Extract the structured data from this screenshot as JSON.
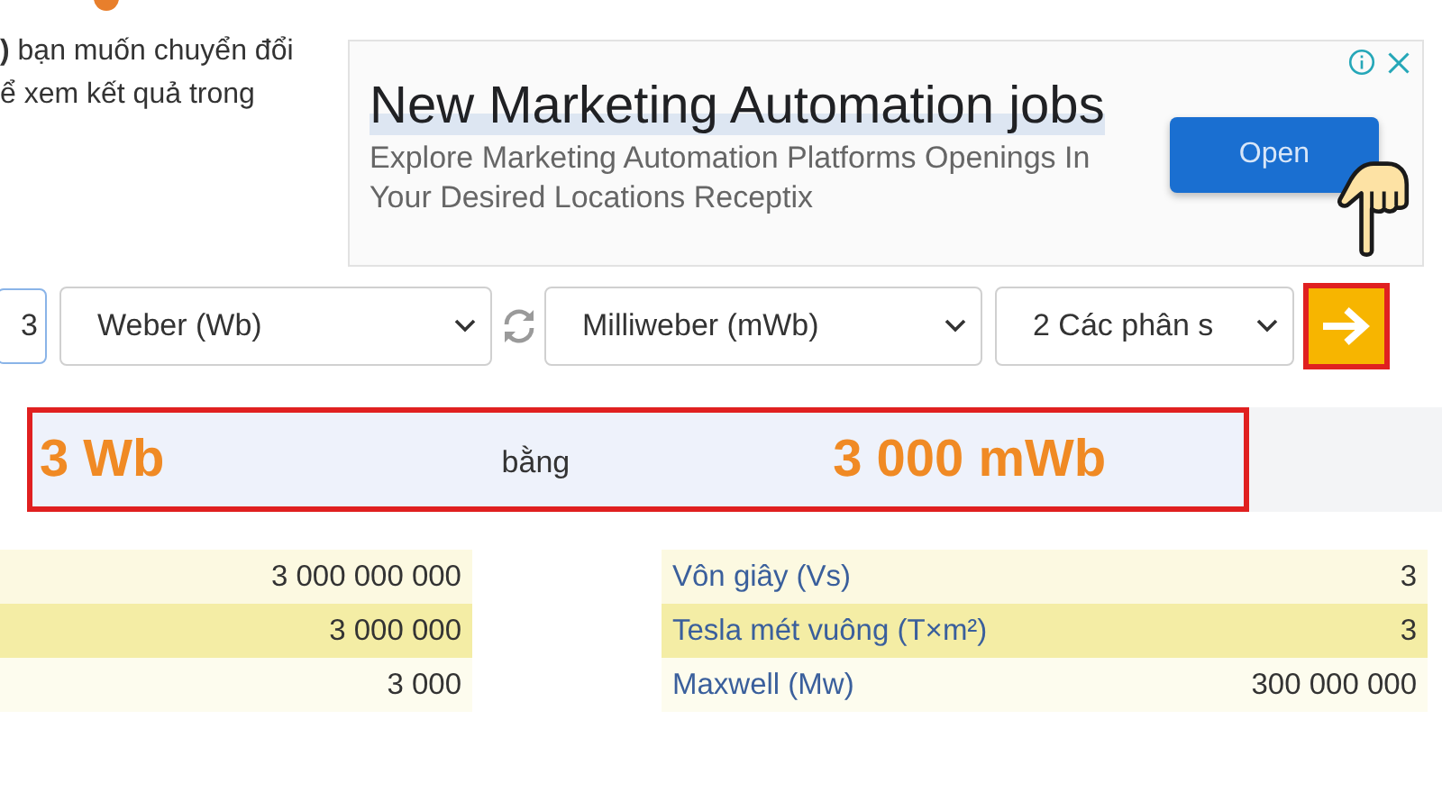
{
  "intro": {
    "lines": [
      "**)** bạn muốn chuyển đổi",
      "ể xem kết quả trong"
    ]
  },
  "ad": {
    "title": "New Marketing Automation jobs",
    "description": "Explore Marketing Automation Platforms Openings In Your Desired Locations Receptix",
    "button": "Open"
  },
  "converter": {
    "amount": "3",
    "from_unit": "Weber (Wb)",
    "to_unit": "Milliweber (mWb)",
    "precision": "2 Các phân s"
  },
  "result": {
    "from": "3 Wb",
    "connector": "bằng",
    "to": "3 000 mWb"
  },
  "left_table": {
    "rows": [
      {
        "value": "3 000 000 000"
      },
      {
        "value": "3 000 000"
      },
      {
        "value": "3 000"
      }
    ]
  },
  "right_table": {
    "rows": [
      {
        "unit": "Vôn giây (Vs)",
        "value": "3"
      },
      {
        "unit": "Tesla mét vuông (T×m²)",
        "value": "3"
      },
      {
        "unit": "Maxwell (Mw)",
        "value": "300 000 000"
      }
    ]
  }
}
